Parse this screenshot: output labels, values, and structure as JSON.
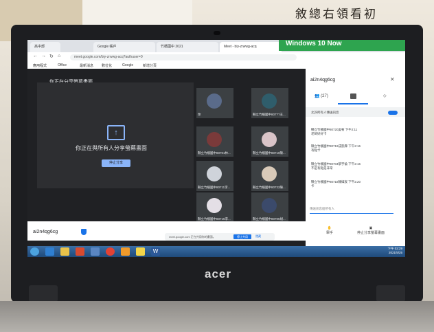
{
  "room": {
    "calligraphy": "敘總右領看初"
  },
  "laptop": {
    "brand": "acer"
  },
  "browser": {
    "tabs": [
      "高中部",
      "Google 帳戶",
      "竹檳國中 2021",
      "Meet - biy-zrwwg-acq",
      ""
    ],
    "url": "meet.google.com/biy-zrwwg-acq?authuser=0",
    "bookmarks": [
      "應用程式",
      "Office",
      "最新消息",
      "數位化",
      "Google",
      "新增分頁"
    ]
  },
  "windows_promo": {
    "label": "Windows 10 Now"
  },
  "meet": {
    "presenting_banner": "你正在分享螢幕畫面",
    "share_message": "你正在與所有人分享螢幕畫面",
    "stop_button": "停止分享",
    "participants": [
      {
        "name": "你"
      },
      {
        "name": "縣立竹檳國中807??王..."
      },
      {
        "name": "縣立竹檳國中80701林..."
      },
      {
        "name": "縣立竹檳國中80710陳..."
      },
      {
        "name": "縣立竹檳國中80711李..."
      },
      {
        "name": "縣立竹檳國中80722陳..."
      },
      {
        "name": "縣立竹檳國中80715李..."
      },
      {
        "name": "縣立竹檳國中80705胡..."
      }
    ],
    "meeting_code": "ai2n4qg6cg"
  },
  "panel": {
    "title": "ai2n4qg6cg",
    "people_count": "(27)",
    "toggle_label": "允許所有人傳送訊息",
    "messages": [
      {
        "sender": "縣立竹檳國中80720吳宥",
        "time": "下午2:11",
        "text": "老師好好卡"
      },
      {
        "sender": "縣立竹檳國中80719成凱霖",
        "time": "下午2:16",
        "text": "有點卡"
      },
      {
        "sender": "縣立竹檳國中80704蔡宇倫",
        "time": "下午2:16",
        "text": "不是有點是非常"
      },
      {
        "sender": "縣立竹檳國中80718陳緯宸",
        "time": "下午2:20",
        "text": "卡"
      }
    ],
    "input_placeholder": "傳送訊息給所有人"
  },
  "notice": {
    "text": "meet.google.com 正在共用你的畫面。",
    "stop": "停止共用",
    "hide": "隱藏"
  },
  "controls": {
    "raise_hand": "舉手",
    "stop_presenting": "停止分享螢幕畫面"
  },
  "taskbar": {
    "time": "下午 02:29",
    "date": "2021/5/25"
  }
}
